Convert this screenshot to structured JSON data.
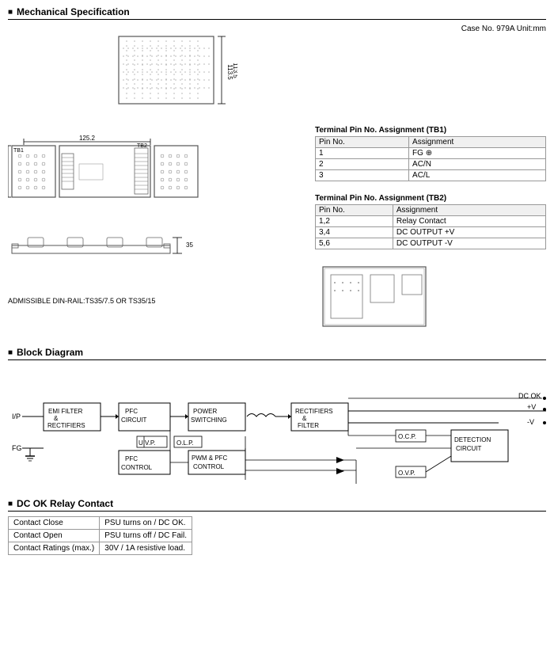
{
  "sections": {
    "mechanical": {
      "title": "Mechanical Specification",
      "case_info": "Case No. 979A    Unit:mm",
      "din_label": "ADMISSIBLE DIN-RAIL:TS35/7.5 OR TS35/15",
      "terminal_tb1": {
        "title": "Terminal Pin No.  Assignment (TB1)",
        "headers": [
          "Pin No.",
          "Assignment"
        ],
        "rows": [
          [
            "1",
            "FG ⊕"
          ],
          [
            "2",
            "AC/N"
          ],
          [
            "3",
            "AC/L"
          ]
        ]
      },
      "terminal_tb2": {
        "title": "Terminal Pin No.  Assignment (TB2)",
        "headers": [
          "Pin No.",
          "Assignment"
        ],
        "rows": [
          [
            "1,2",
            "Relay Contact"
          ],
          [
            "3,4",
            "DC OUTPUT +V"
          ],
          [
            "5,6",
            "DC OUTPUT -V"
          ]
        ]
      }
    },
    "block_diagram": {
      "title": "Block Diagram"
    },
    "dc_ok": {
      "title": "DC OK Relay Contact",
      "headers": [
        "",
        ""
      ],
      "rows": [
        [
          "Contact Close",
          "PSU turns on / DC OK."
        ],
        [
          "Contact Open",
          "PSU turns off / DC Fail."
        ],
        [
          "Contact Ratings (max.)",
          "30V / 1A resistive load."
        ]
      ]
    }
  }
}
